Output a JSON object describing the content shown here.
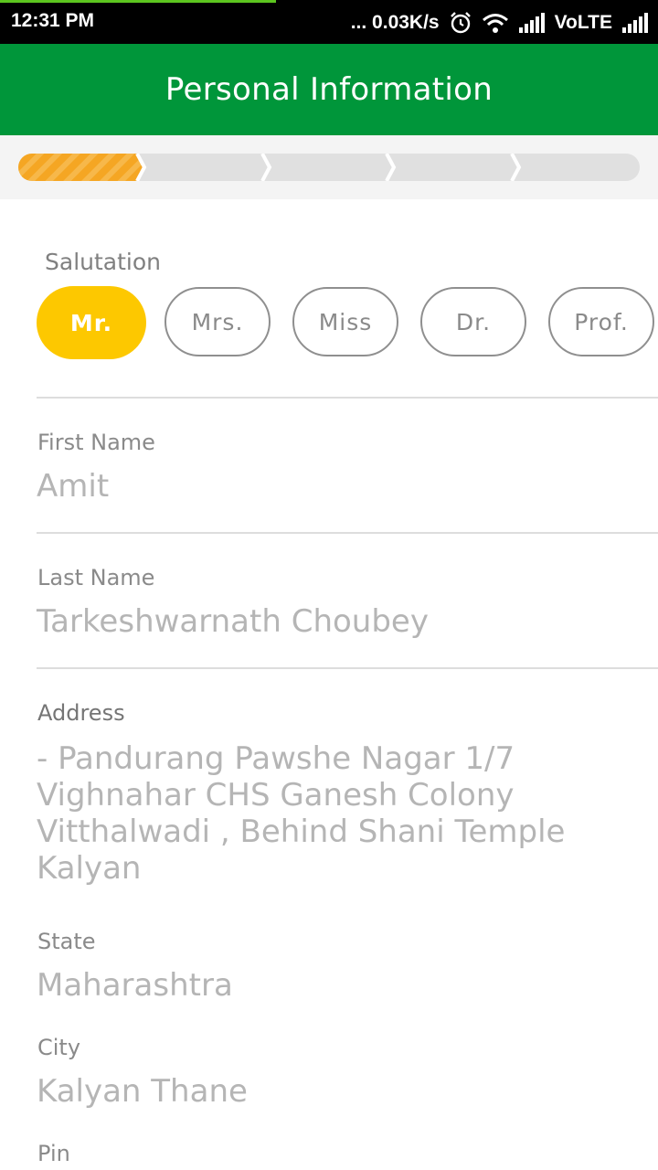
{
  "status_bar": {
    "time": "12:31 PM",
    "network_speed": "... 0.03K/s",
    "network_type": "VoLTE",
    "icons": [
      "alarm-icon",
      "wifi-icon",
      "signal-icon",
      "signal-icon"
    ]
  },
  "app_bar": {
    "title": "Personal Information"
  },
  "stepper": {
    "total_steps": 5,
    "current_step": 1,
    "active_color": "#f5a623",
    "inactive_color": "#e0e0e0"
  },
  "salutation": {
    "label": "Salutation",
    "options": [
      "Mr.",
      "Mrs.",
      "Miss",
      "Dr.",
      "Prof."
    ],
    "selected": "Mr."
  },
  "fields": {
    "first_name": {
      "label": "First Name",
      "value": "Amit"
    },
    "last_name": {
      "label": "Last Name",
      "value": "Tarkeshwarnath Choubey"
    },
    "address": {
      "label": "Address",
      "lines": [
        "- Pandurang Pawshe Nagar 1/7",
        "Vighnahar CHS Ganesh Colony",
        "Vitthalwadi , Behind Shani Temple",
        "Kalyan"
      ]
    },
    "state": {
      "label": "State",
      "value": "Maharashtra"
    },
    "city": {
      "label": "City",
      "value": "Kalyan Thane"
    },
    "pin": {
      "label": "Pin"
    }
  },
  "colors": {
    "brand_green": "#00963a",
    "selected_chip": "#fdc800"
  }
}
